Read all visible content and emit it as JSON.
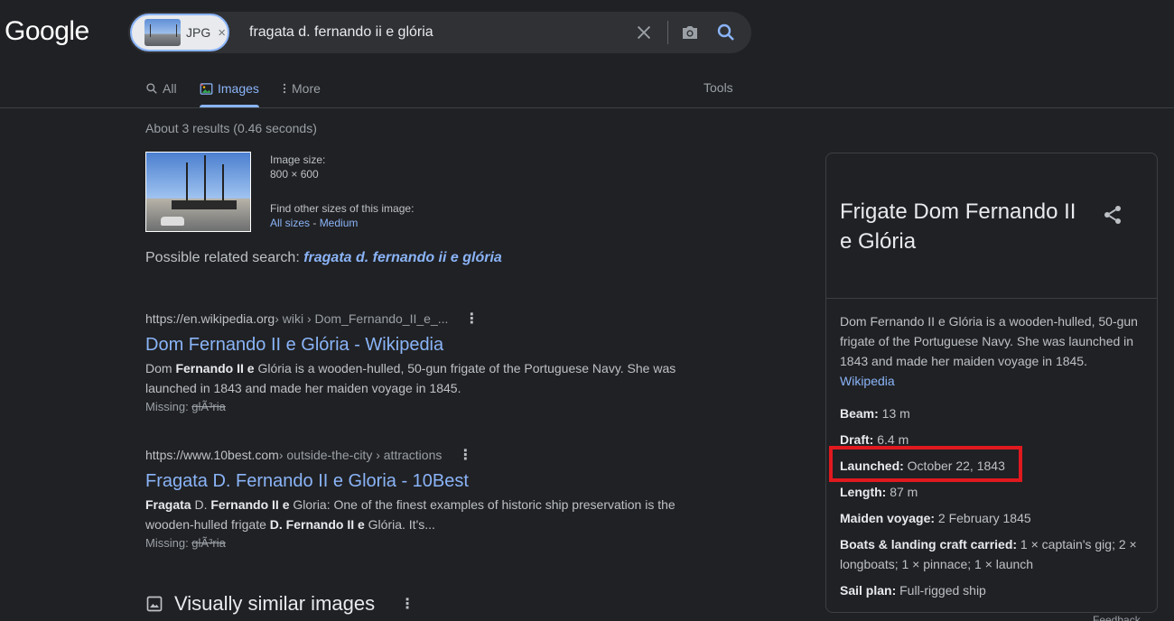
{
  "logo": "Google",
  "search": {
    "chip_label": "JPG",
    "chip_close": "×",
    "query": "fragata d. fernando ii e glória"
  },
  "tabs": [
    {
      "label": "All"
    },
    {
      "label": "Images"
    },
    {
      "label": "More"
    }
  ],
  "tools": "Tools",
  "stats": "About 3 results (0.46 seconds)",
  "image_info": {
    "size_label": "Image size:",
    "size_value": "800 × 600",
    "other_sizes_label": "Find other sizes of this image:",
    "all_sizes": "All sizes",
    "sep": " - ",
    "medium": "Medium"
  },
  "related": {
    "prefix": "Possible related search: ",
    "term": "fragata d. fernando ii e glória"
  },
  "results": [
    {
      "domain": "https://en.wikipedia.org",
      "path": " › wiki › Dom_Fernando_II_e_...",
      "title": "Dom Fernando II e Glória - Wikipedia",
      "snippet_pre": "Dom ",
      "snippet_bold": "Fernando II e",
      "snippet_post": " Glória is a wooden-hulled, 50-gun frigate of the Portuguese Navy. She was launched in 1843 and made her maiden voyage in 1845.",
      "missing_label": "Missing: ",
      "missing_term": "glÃ³ria"
    },
    {
      "domain": "https://www.10best.com",
      "path": " › outside-the-city › attractions",
      "title": "Fragata D. Fernando II e Gloria - 10Best",
      "s1": "Fragata",
      "s2": " D. ",
      "s3": "Fernando II e",
      "s4": " Gloria: One of the finest examples of historic ship preservation is the wooden-hulled frigate ",
      "s5": "D. Fernando II e",
      "s6": " Glória. It's...",
      "missing_label": "Missing: ",
      "missing_term": "glÃ³ria"
    }
  ],
  "similar_label": "Visually similar images",
  "knowledge_panel": {
    "title": "Frigate Dom Fernando II e Glória",
    "description": "Dom Fernando II e Glória is a wooden-hulled, 50-gun frigate of the Portuguese Navy. She was launched in 1843 and made her maiden voyage in 1845.",
    "source": "Wikipedia",
    "facts": [
      {
        "label": "Beam:",
        "value": " 13 m"
      },
      {
        "label": "Draft:",
        "value": " 6.4 m"
      },
      {
        "label": "Launched:",
        "value": " October 22, 1843"
      },
      {
        "label": "Length:",
        "value": " 87 m"
      },
      {
        "label": "Maiden voyage:",
        "value": " 2 February 1845"
      },
      {
        "label": "Boats & landing craft carried:",
        "value": " 1 × captain's gig; 2 × longboats; 1 × pinnace; 1 × launch"
      },
      {
        "label": "Sail plan:",
        "value": " Full-rigged ship"
      }
    ],
    "feedback": "Feedback"
  },
  "colors": {
    "background": "#202124",
    "link": "#8ab4f8",
    "highlight": "#e0191f"
  }
}
